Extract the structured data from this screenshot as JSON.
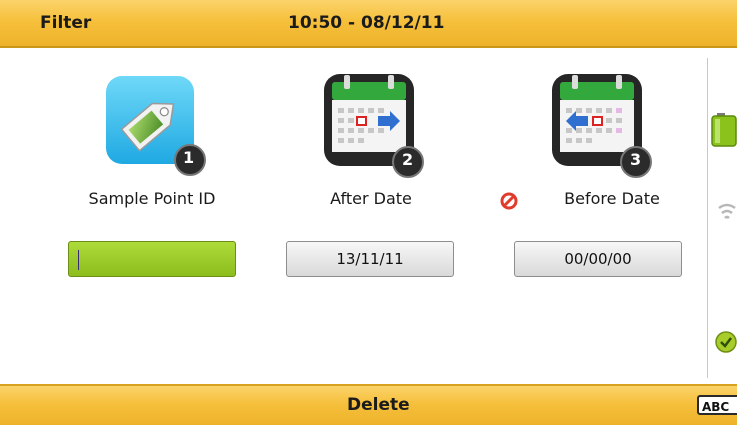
{
  "header": {
    "title": "Filter",
    "datetime": "10:50 - 08/12/11"
  },
  "filters": [
    {
      "label": "Sample Point ID",
      "badge": "1",
      "value": ""
    },
    {
      "label": "After Date",
      "badge": "2",
      "value": "13/11/11"
    },
    {
      "label": "Before Date",
      "badge": "3",
      "value": "00/00/00"
    }
  ],
  "footer": {
    "action": "Delete",
    "input_mode": "ABC"
  },
  "colors": {
    "bar": "#f6c03c",
    "active_field": "#9ccc2a",
    "calendar_green": "#2fa63a",
    "tag_blue": "#3ec3ef"
  }
}
